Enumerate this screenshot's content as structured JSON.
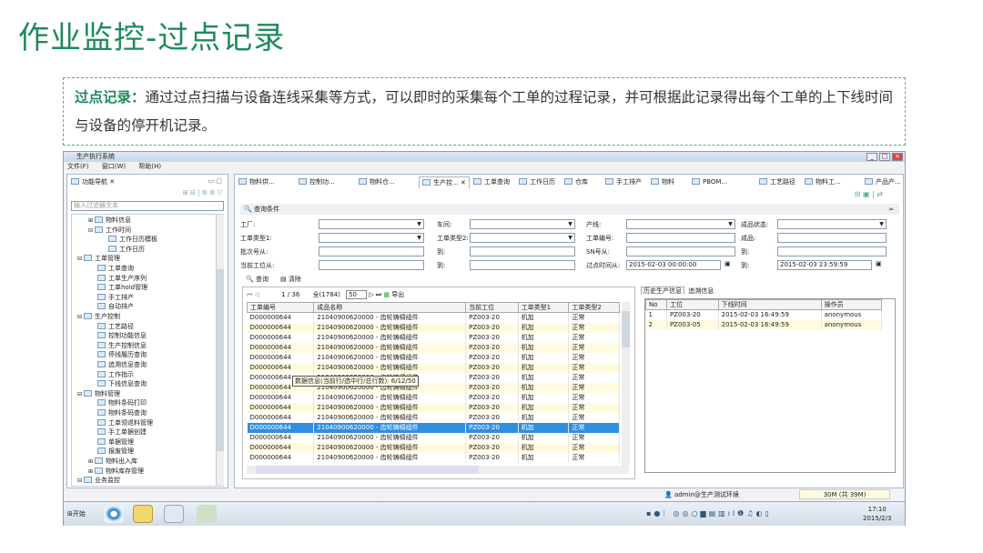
{
  "slide": {
    "title": "作业监控-过点记录",
    "intro_label": "过点记录：",
    "intro_text": "通过过点扫描与设备连线采集等方式，可以即时的采集每个工单的过程记录，并可根据此记录得出每个工单的上下线时间与设备的停开机记录。"
  },
  "window": {
    "title": "生产执行系统",
    "menu": [
      "文件(F)",
      "窗口(W)",
      "帮助(H)"
    ]
  },
  "nav": {
    "title": "功能导航",
    "filter_placeholder": "输入过滤器文本",
    "items": [
      {
        "label": "物料信息",
        "level": 1,
        "type": "folder",
        "expand": "+"
      },
      {
        "label": "工作时间",
        "level": 1,
        "type": "folder",
        "expand": "-"
      },
      {
        "label": "工作日历模板",
        "level": 2,
        "type": "leaf"
      },
      {
        "label": "工作日历",
        "level": 2,
        "type": "leaf"
      },
      {
        "label": "工单管理",
        "level": 0,
        "type": "folder",
        "expand": "-"
      },
      {
        "label": "工单查询",
        "level": 1,
        "type": "leaf"
      },
      {
        "label": "工单生产序列",
        "level": 1,
        "type": "leaf"
      },
      {
        "label": "工单hold管理",
        "level": 1,
        "type": "leaf"
      },
      {
        "label": "手工排产",
        "level": 1,
        "type": "leaf"
      },
      {
        "label": "自动排产",
        "level": 1,
        "type": "leaf"
      },
      {
        "label": "生产控制",
        "level": 0,
        "type": "folder",
        "expand": "-"
      },
      {
        "label": "工艺路径",
        "level": 1,
        "type": "leaf"
      },
      {
        "label": "控制功能信息",
        "level": 1,
        "type": "leaf"
      },
      {
        "label": "生产控制信息",
        "level": 1,
        "type": "leaf"
      },
      {
        "label": "停线履历查询",
        "level": 1,
        "type": "leaf"
      },
      {
        "label": "追溯信息查询",
        "level": 1,
        "type": "leaf"
      },
      {
        "label": "工作指示",
        "level": 1,
        "type": "leaf"
      },
      {
        "label": "下线信息查询",
        "level": 1,
        "type": "leaf"
      },
      {
        "label": "物料管理",
        "level": 0,
        "type": "folder",
        "expand": "-"
      },
      {
        "label": "物料条码打印",
        "level": 1,
        "type": "leaf"
      },
      {
        "label": "物料条码查询",
        "level": 1,
        "type": "leaf"
      },
      {
        "label": "工单领退料管理",
        "level": 1,
        "type": "leaf"
      },
      {
        "label": "手工单据创建",
        "level": 1,
        "type": "leaf"
      },
      {
        "label": "单据管理",
        "level": 1,
        "type": "leaf"
      },
      {
        "label": "报废管理",
        "level": 1,
        "type": "leaf"
      },
      {
        "label": "物料出入库",
        "level": 1,
        "type": "folder",
        "expand": "+"
      },
      {
        "label": "物料库存管理",
        "level": 1,
        "type": "folder",
        "expand": "+"
      },
      {
        "label": "业务监控",
        "level": 0,
        "type": "folder",
        "expand": "-"
      }
    ]
  },
  "tabs": [
    "物料供...",
    "控制功...",
    "物料仓...",
    "生产控...",
    "工单查询",
    "工作日历",
    "仓库",
    "手工排产",
    "物料",
    "PBOM...",
    "工艺路径",
    "物料工...",
    "产品产..."
  ],
  "active_tab": 3,
  "query": {
    "section_title": "查询条件",
    "fields": [
      {
        "label": "工厂:",
        "value": "",
        "dropdown": true
      },
      {
        "label": "车间:",
        "value": "",
        "dropdown": true
      },
      {
        "label": "产线:",
        "value": "",
        "dropdown": true
      },
      {
        "label": "成品状态:",
        "value": "",
        "dropdown": true
      },
      {
        "label": "工单类型1:",
        "value": "",
        "dropdown": true
      },
      {
        "label": "工单类型2:",
        "value": "",
        "dropdown": true
      },
      {
        "label": "工单编号:",
        "value": "",
        "dropdown": false
      },
      {
        "label": "成品:",
        "value": "",
        "dropdown": false
      },
      {
        "label": "批次号从:",
        "value": "",
        "dropdown": false
      },
      {
        "label": "到:",
        "value": "",
        "dropdown": false
      },
      {
        "label": "SN号从:",
        "value": "",
        "dropdown": false
      },
      {
        "label": "到:",
        "value": "",
        "dropdown": false
      },
      {
        "label": "当前工位从:",
        "value": "",
        "dropdown": false
      },
      {
        "label": "到:",
        "value": "",
        "dropdown": false
      },
      {
        "label": "过点时间从:",
        "value": "2015-02-03 00:00:00",
        "dropdown": false
      },
      {
        "label": "到:",
        "value": "2015-02-03 23:59:59",
        "dropdown": false
      }
    ],
    "search_label": "查询",
    "clear_label": "清除"
  },
  "pager": {
    "page": "1 / 36",
    "total": "全(1784)",
    "page_size": "50",
    "export_label": "导出"
  },
  "grid": {
    "columns": [
      "工单编号",
      "成品名称",
      "当前工位",
      "工单类型1",
      "工单类型2"
    ],
    "rows": [
      [
        "D000000644",
        "21040900620000 - 齿轮铸绸组件",
        "PZ003-20",
        "机加",
        "正常"
      ],
      [
        "D000000644",
        "21040900620000 - 齿轮铸绸组件",
        "PZ003-20",
        "机加",
        "正常"
      ],
      [
        "D000000644",
        "21040900620000 - 齿轮铸绸组件",
        "PZ003-20",
        "机加",
        "正常"
      ],
      [
        "D000000644",
        "21040900620000 - 齿轮铸绸组件",
        "PZ003-20",
        "机加",
        "正常"
      ],
      [
        "D000000644",
        "21040900620000 - 齿轮铸绸组件",
        "PZ003-20",
        "机加",
        "正常"
      ],
      [
        "D000000644",
        "21040900620000 - 齿轮铸绸组件",
        "PZ003-20",
        "机加",
        "正常"
      ],
      [
        "D000000644",
        "21040900620000 - 齿轮铸绸组件",
        "PZ003-20",
        "机加",
        "正常"
      ],
      [
        "D000000644",
        "21040900620000 - 齿轮铸绸组件",
        "PZ003-20",
        "机加",
        "正常"
      ],
      [
        "D000000644",
        "21040900620000 - 齿轮铸绸组件",
        "PZ003-20",
        "机加",
        "正常"
      ],
      [
        "D000000644",
        "21040900620000 - 齿轮铸绸组件",
        "PZ003-20",
        "机加",
        "正常"
      ],
      [
        "D000000644",
        "21040900620000 - 齿轮铸绸组件",
        "PZ003-20",
        "机加",
        "正常"
      ],
      [
        "D000000644",
        "21040900620000 - 齿轮铸绸组件",
        "PZ003-20",
        "机加",
        "正常"
      ],
      [
        "D000000644",
        "21040900620000 - 齿轮铸绸组件",
        "PZ003-20",
        "机加",
        "正常"
      ],
      [
        "D000000644",
        "21040900620000 - 齿轮铸绸组件",
        "PZ003-20",
        "机加",
        "正常"
      ],
      [
        "D000000644",
        "21040900620000 - 齿轮铸绸组件",
        "PZ003-20",
        "机加",
        "正常"
      ]
    ],
    "selected_row": 11,
    "tooltip": "数据信息(当前行/选中行/总行数): 6/12/50"
  },
  "history": {
    "tabs": [
      "历史生产信息",
      "追溯信息"
    ],
    "columns": [
      "No",
      "工位",
      "下线时间",
      "操作员"
    ],
    "rows": [
      [
        "1",
        "PZ003-20",
        "2015-02-03 16:49:59",
        "anonymous"
      ],
      [
        "2",
        "PZ003-05",
        "2015-02-03 16:49:59",
        "anonymous"
      ]
    ]
  },
  "status": {
    "user": "admin@生产测试环境",
    "memory": "30M (共 39M)"
  },
  "taskbar": {
    "start": "开始",
    "time": "17:10",
    "date": "2015/2/3"
  }
}
